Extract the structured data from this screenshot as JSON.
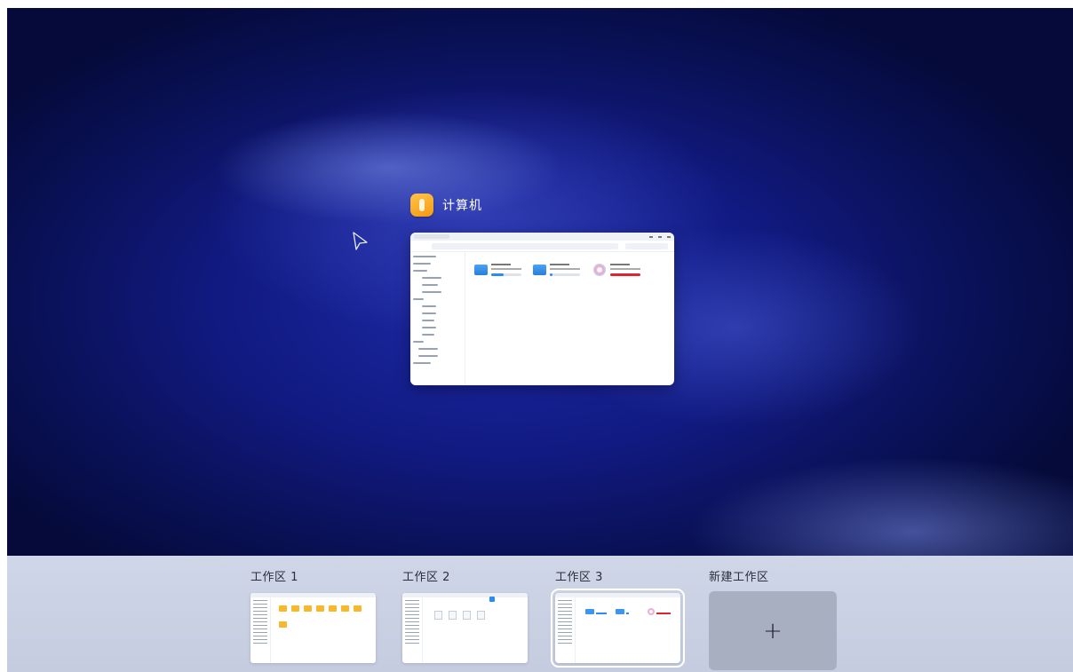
{
  "desktop": {
    "window": {
      "app_title": "计算机",
      "app_icon": "file-manager-icon"
    }
  },
  "workspaces": [
    {
      "label": "工作区 1",
      "active": false
    },
    {
      "label": "工作区 2",
      "active": false
    },
    {
      "label": "工作区 3",
      "active": true
    }
  ],
  "new_workspace": {
    "label": "新建工作区",
    "button_symbol": "+"
  },
  "colors": {
    "accent": "#2a8cf0",
    "warning": "#e0242f",
    "folder": "#f7b82b"
  }
}
